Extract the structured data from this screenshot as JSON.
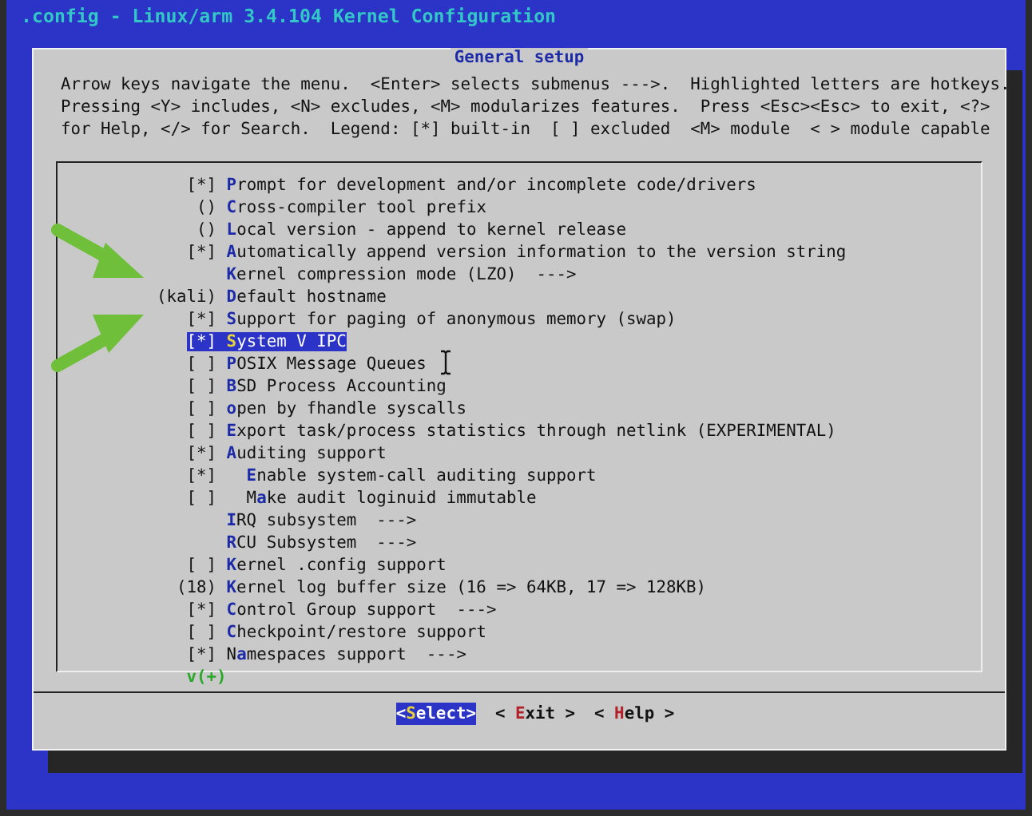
{
  "window": {
    "title": ".config - Linux/arm 3.4.104 Kernel Configuration"
  },
  "dialog": {
    "title": "General setup",
    "help_lines": [
      "Arrow keys navigate the menu.  <Enter> selects submenus --->.  Highlighted letters are hotkeys.",
      "Pressing <Y> includes, <N> excludes, <M> modularizes features.  Press <Esc><Esc> to exit, <?>",
      "for Help, </> for Search.  Legend: [*] built-in  [ ] excluded  <M> module  < > module capable"
    ],
    "items": [
      {
        "prefix": "[*]",
        "hotkey": "P",
        "after": "rompt for development and/or incomplete code/drivers",
        "selected": false
      },
      {
        "prefix": "()",
        "hotkey": "C",
        "after": "ross-compiler tool prefix",
        "selected": false
      },
      {
        "prefix": "()",
        "hotkey": "L",
        "after": "ocal version - append to kernel release",
        "selected": false
      },
      {
        "prefix": "[*]",
        "hotkey": "A",
        "after": "utomatically append version information to the version string",
        "selected": false
      },
      {
        "hotkey": "K",
        "after": "ernel compression mode (LZO)  --->",
        "selected": false
      },
      {
        "prefix": "(kali)",
        "hotkey": "D",
        "after": "efault hostname",
        "selected": false
      },
      {
        "prefix": "[*]",
        "hotkey": "S",
        "after": "upport for paging of anonymous memory (swap)",
        "selected": false
      },
      {
        "prefix": "[*]",
        "hotkey": "S",
        "after": "ystem V IPC",
        "selected": true
      },
      {
        "prefix": "[ ]",
        "hotkey": "P",
        "after": "OSIX Message Queues",
        "selected": false
      },
      {
        "prefix": "[ ]",
        "hotkey": "B",
        "after": "SD Process Accounting",
        "selected": false
      },
      {
        "prefix": "[ ]",
        "hotkey": "o",
        "after": "pen by fhandle syscalls",
        "selected": false
      },
      {
        "prefix": "[ ]",
        "hotkey": "E",
        "after": "xport task/process statistics through netlink (EXPERIMENTAL)",
        "selected": false
      },
      {
        "prefix": "[*]",
        "hotkey": "A",
        "after": "uditing support",
        "selected": false,
        "children": [
          {
            "prefix": "[*]",
            "hotkey": "E",
            "after": "nable system-call auditing support",
            "selected": false
          },
          {
            "prefix": "[ ]",
            "before": "M",
            "hotkey": "a",
            "after": "ke audit loginuid immutable",
            "selected": false
          }
        ]
      },
      {
        "hotkey": "I",
        "after": "RQ subsystem  --->",
        "selected": false
      },
      {
        "hotkey": "R",
        "after": "CU Subsystem  --->",
        "selected": false
      },
      {
        "prefix": "[ ]",
        "hotkey": "K",
        "after": "ernel .config support",
        "selected": false
      },
      {
        "prefix": "(18)",
        "hotkey": "K",
        "after": "ernel log buffer size (16 => 64KB, 17 => 128KB)",
        "selected": false
      },
      {
        "prefix": "[*]",
        "hotkey": "C",
        "after": "ontrol Group support  --->",
        "selected": false
      },
      {
        "prefix": "[ ]",
        "hotkey": "C",
        "after": "heckpoint/restore support",
        "selected": false
      },
      {
        "prefix": "[*]",
        "before": "N",
        "hotkey": "a",
        "after": "mespaces support  --->",
        "selected": false
      }
    ],
    "more_indicator": "v(+)",
    "buttons": [
      {
        "before": "<",
        "hotkey": "S",
        "after": "elect>",
        "selected": true
      },
      {
        "before": "< ",
        "hotkey": "E",
        "after": "xit >",
        "selected": false
      },
      {
        "before": "< ",
        "hotkey": "H",
        "after": "elp >",
        "selected": false
      }
    ]
  }
}
